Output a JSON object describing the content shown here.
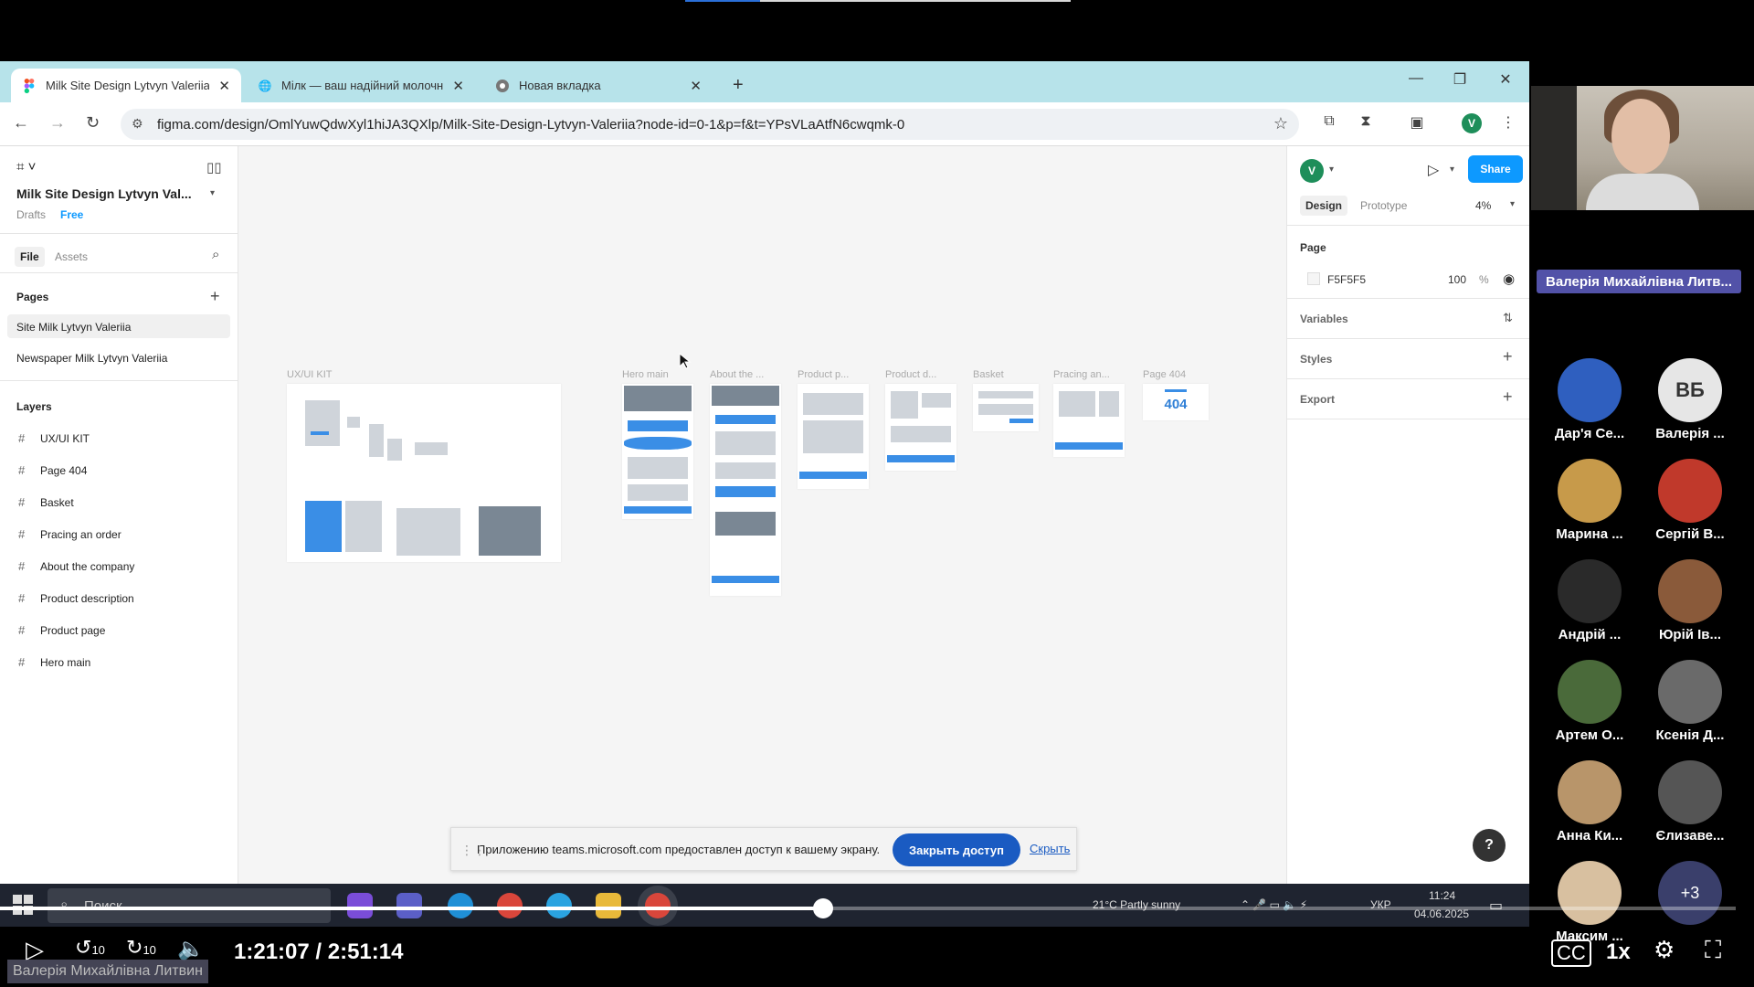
{
  "browser": {
    "tabs": [
      {
        "title": "Milk Site Design Lytvyn Valeriia",
        "icon": "figma-icon",
        "active": true
      },
      {
        "title": "Мілк — ваш надійний молочн",
        "icon": "globe-icon",
        "active": false
      },
      {
        "title": "Новая вкладка",
        "icon": "chrome-icon",
        "active": false
      }
    ],
    "new_tab": "+",
    "url": "figma.com/design/OmlYuwQdwXyl1hiJA3QXlp/Milk-Site-Design-Lytvyn-Valeriia?node-id=0-1&p=f&t=YPsVLaAtfN6cwqmk-0",
    "profile_initial": "V"
  },
  "figma": {
    "file_title": "Milk Site Design Lytvyn Val...",
    "drafts": "Drafts",
    "plan": "Free",
    "tabs": {
      "file": "File",
      "assets": "Assets"
    },
    "pages_header": "Pages",
    "pages": [
      "Site Milk Lytvyn Valeriia",
      "Newspaper Milk Lytvyn Valeriia"
    ],
    "layers_header": "Layers",
    "layers": [
      "UX/UI KIT",
      "Page 404",
      "Basket",
      "Pracing an order",
      "About the company",
      "Product description",
      "Product page",
      "Hero main"
    ],
    "canvas_labels": [
      "UX/UI KIT",
      "Hero main",
      "About the ...",
      "Product p...",
      "Product d...",
      "Basket",
      "Pracing an...",
      "Page 404"
    ],
    "page_404_text": "404",
    "right": {
      "avatar": "V",
      "share": "Share",
      "tab_design": "Design",
      "tab_prototype": "Prototype",
      "zoom": "4%",
      "page_header": "Page",
      "bg_hex": "F5F5F5",
      "opacity": "100",
      "percent": "%",
      "variables": "Variables",
      "styles": "Styles",
      "export": "Export"
    },
    "help": "?"
  },
  "notice": {
    "text": "Приложению teams.microsoft.com предоставлен доступ к вашему экрану.",
    "stop": "Закрыть доступ",
    "hide": "Скрыть"
  },
  "taskbar": {
    "search": "Поиск",
    "weather": "21°C  Partly sunny",
    "lang": "УКР",
    "time": "11:24",
    "date": "04.06.2025"
  },
  "meeting": {
    "speaker_name": "Валерія Михайлівна Литв...",
    "participants": [
      {
        "name": "Дар'я Се...",
        "color": "#2f5fbf"
      },
      {
        "name": "Валерія ...",
        "initials": "ВБ"
      },
      {
        "name": "Марина ...",
        "color": "#c79a4a"
      },
      {
        "name": "Сергій В...",
        "color": "#c0392b"
      },
      {
        "name": "Андрій ...",
        "color": "#2a2a2a"
      },
      {
        "name": "Юрій Ів...",
        "color": "#8a5a3a"
      },
      {
        "name": "Артем О...",
        "color": "#4a6a3a"
      },
      {
        "name": "Ксенія Д...",
        "color": "#6a6a6a"
      },
      {
        "name": "Анна Ки...",
        "color": "#b8956a"
      },
      {
        "name": "Єлизаве...",
        "color": "#555555"
      },
      {
        "name": "Максим ...",
        "color": "#d8c0a0"
      },
      {
        "more": "+3"
      }
    ]
  },
  "player": {
    "time": "1:21:07 / 2:51:14",
    "progress": 0.474,
    "skip_back": "10",
    "skip_fwd": "10",
    "speed": "1x",
    "presenter_caption": "Валерія Михайлівна Литвин"
  }
}
